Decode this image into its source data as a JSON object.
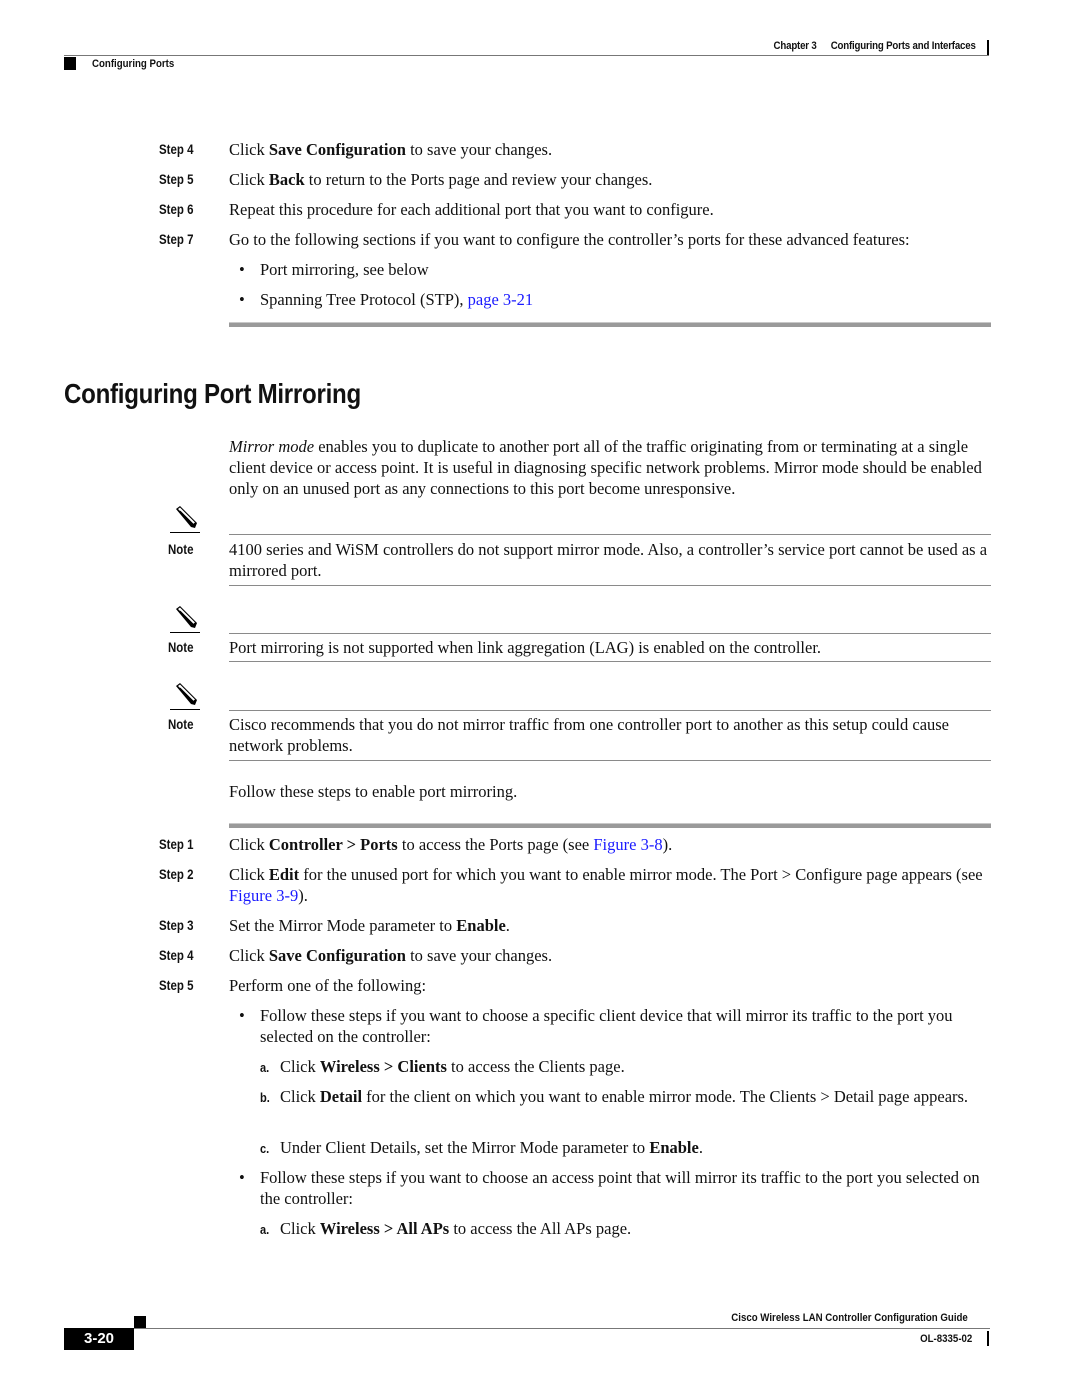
{
  "header": {
    "chapter": "Chapter 3",
    "chapter_title": "Configuring Ports and Interfaces",
    "section": "Configuring Ports"
  },
  "steps_top": [
    {
      "label": "Step 4",
      "pre": "Click ",
      "bold": "Save Configuration",
      "post": " to save your changes."
    },
    {
      "label": "Step 5",
      "pre": "Click ",
      "bold": "Back",
      "post": " to return to the Ports page and review your changes."
    },
    {
      "label": "Step 6",
      "text": "Repeat this procedure for each additional port that you want to configure."
    },
    {
      "label": "Step 7",
      "text": "Go to the following sections if you want to configure the controller’s ports for these advanced features:"
    }
  ],
  "step7_bullets": [
    {
      "text": "Port mirroring, see below"
    },
    {
      "text": "Spanning Tree Protocol (STP), ",
      "link": "page 3-21"
    }
  ],
  "section_title": "Configuring Port Mirroring",
  "intro": {
    "italic": "Mirror mode",
    "text": " enables you to duplicate to another port all of the traffic originating from or terminating at a single client device or access point. It is useful in diagnosing specific network problems. Mirror mode should be enabled only on an unused port as any connections to this port become unresponsive."
  },
  "notes": [
    {
      "label": "Note",
      "text": "4100 series and WiSM controllers do not support mirror mode. Also, a controller’s service port cannot be used as a mirrored port."
    },
    {
      "label": "Note",
      "text": "Port mirroring is not supported when link aggregation (LAG) is enabled on the controller."
    },
    {
      "label": "Note",
      "text": "Cisco recommends that you do not mirror traffic from one controller port to another as this setup could cause network problems."
    }
  ],
  "follow_text": "Follow these steps to enable port mirroring.",
  "steps_main": [
    {
      "label": "Step 1",
      "pre": "Click ",
      "bold": "Controller > Ports",
      "mid": " to access the Ports page (see ",
      "link": "Figure 3-8",
      "post": ")."
    },
    {
      "label": "Step 2",
      "pre": "Click ",
      "bold": "Edit",
      "mid": " for the unused port for which you want to enable mirror mode. The Port > Configure page appears (see ",
      "link": "Figure 3-9",
      "post": ")."
    },
    {
      "label": "Step 3",
      "pre": "Set the Mirror Mode parameter to ",
      "bold": "Enable",
      "post": "."
    },
    {
      "label": "Step 4",
      "pre": "Click ",
      "bold": "Save Configuration",
      "post": " to save your changes."
    },
    {
      "label": "Step 5",
      "text": "Perform one of the following:"
    }
  ],
  "step5_bullets": [
    {
      "text": "Follow these steps if you want to choose a specific client device that will mirror its traffic to the port you selected on the controller:",
      "substeps": [
        {
          "label": "a.",
          "pre": "Click ",
          "bold": "Wireless > Clients",
          "post": " to access the Clients page."
        },
        {
          "label": "b.",
          "pre": "Click ",
          "bold": "Detail",
          "post": " for the client on which you want to enable mirror mode. The Clients > Detail page appears."
        },
        {
          "label": "c.",
          "pre": "Under Client Details, set the Mirror Mode parameter to ",
          "bold": "Enable",
          "post": "."
        }
      ]
    },
    {
      "text": "Follow these steps if you want to choose an access point that will mirror its traffic to the port you selected on the controller:",
      "substeps": [
        {
          "label": "a.",
          "pre": "Click ",
          "bold": "Wireless > All APs",
          "post": " to access the All APs page."
        }
      ]
    }
  ],
  "footer": {
    "page_number": "3-20",
    "guide_title": "Cisco Wireless LAN Controller Configuration Guide",
    "doc_number": "OL-8335-02"
  },
  "colors": {
    "link": "#1a1aff",
    "rule": "#9a9a9a"
  }
}
